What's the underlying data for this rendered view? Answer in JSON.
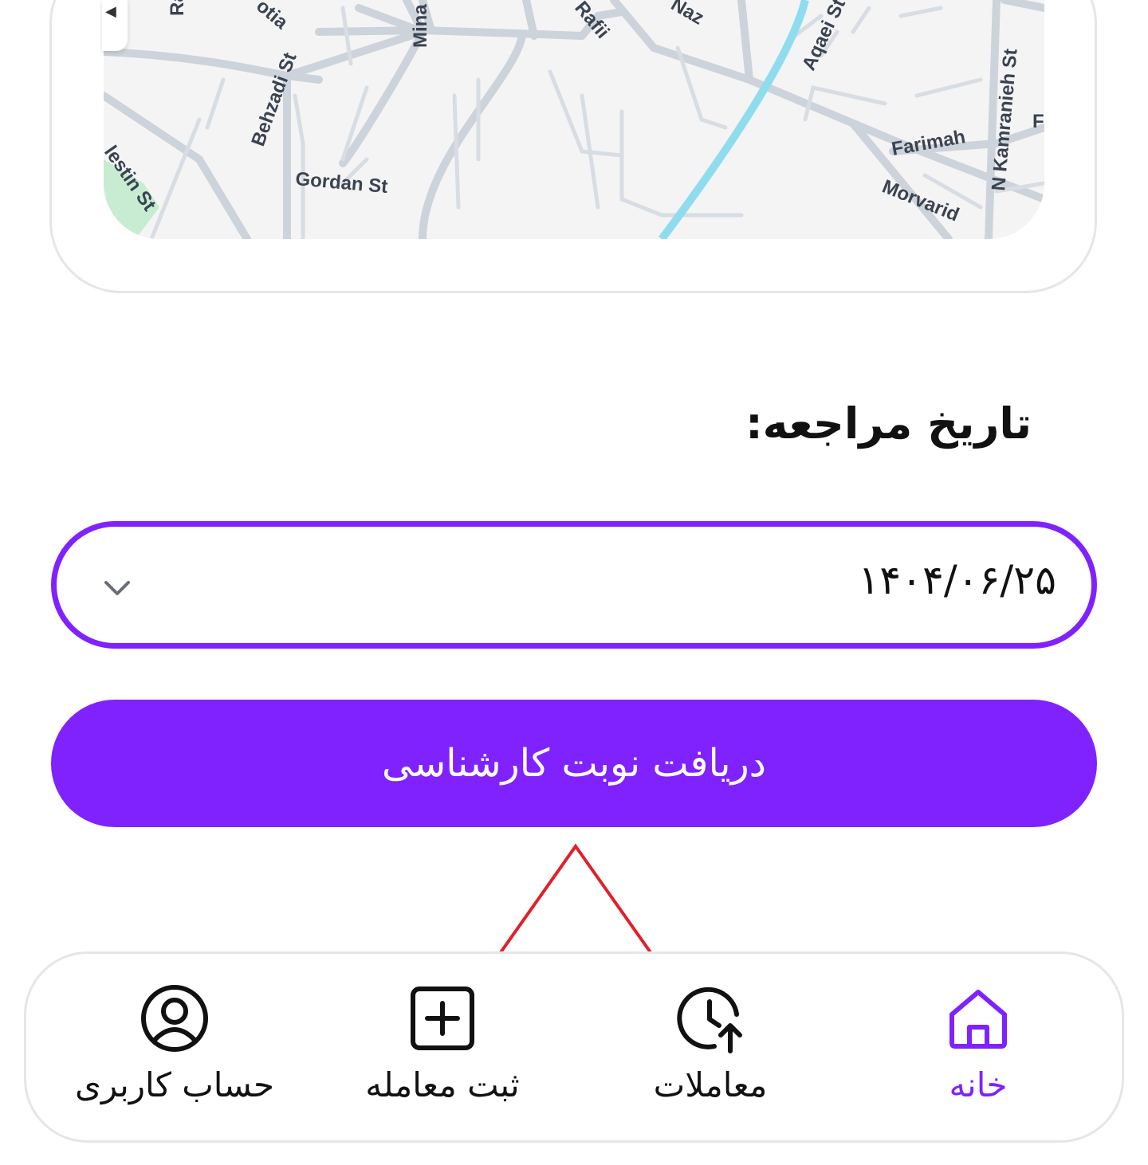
{
  "map": {
    "labels": [
      "Ra",
      "otia",
      "Rafii",
      "Naz",
      "Aqaei St",
      "Mina",
      "Behzadi St",
      "Gordan St",
      "Farimah",
      "Morvarid",
      "N Kamranieh St",
      "lestin St",
      "F"
    ]
  },
  "form": {
    "date_label": "تاریخ مراجعه:",
    "date_value": "۱۴۰۴/۰۶/۲۵",
    "submit_label": "دریافت نوبت کارشناسی"
  },
  "tabs": [
    {
      "label": "خانه",
      "icon": "home-icon",
      "active": true
    },
    {
      "label": "معاملات",
      "icon": "history-icon",
      "active": false
    },
    {
      "label": "ثبت معامله",
      "icon": "add-square-icon",
      "active": false
    },
    {
      "label": "حساب کاربری",
      "icon": "user-circle-icon",
      "active": false
    }
  ],
  "colors": {
    "accent": "#7f22fe",
    "annotation": "#e0202a"
  }
}
